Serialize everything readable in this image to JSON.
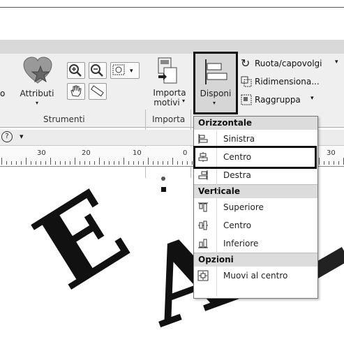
{
  "ribbon": {
    "attributi_label": "Attributi",
    "strumenti_label": "Strumenti",
    "importa_motivi_label_1": "Importa",
    "importa_motivi_label_2": "motivi",
    "importa_group_label": "Importa",
    "disponi_label": "Disponi",
    "ruota_label": "Ruota/capovolgi",
    "ridimensiona_label": "Ridimensiona...",
    "raggruppa_label": "Raggruppa"
  },
  "ruler": {
    "labels": [
      "30",
      "20",
      "10",
      "0",
      "30"
    ]
  },
  "menu": {
    "sections": [
      {
        "title": "Orizzontale",
        "items": [
          "Sinistra",
          "Centro",
          "Destra"
        ]
      },
      {
        "title": "Verticale",
        "items": [
          "Superiore",
          "Centro",
          "Inferiore"
        ]
      },
      {
        "title": "Opzioni",
        "items": [
          "Muovi al centro"
        ]
      }
    ],
    "selected_item": "Centro"
  },
  "canvas": {
    "letter1": "E",
    "letter2": "A"
  },
  "colors": {
    "ribbon_bg": "#efefef",
    "highlight": "#111111",
    "menu_header": "#dcdcdc"
  }
}
